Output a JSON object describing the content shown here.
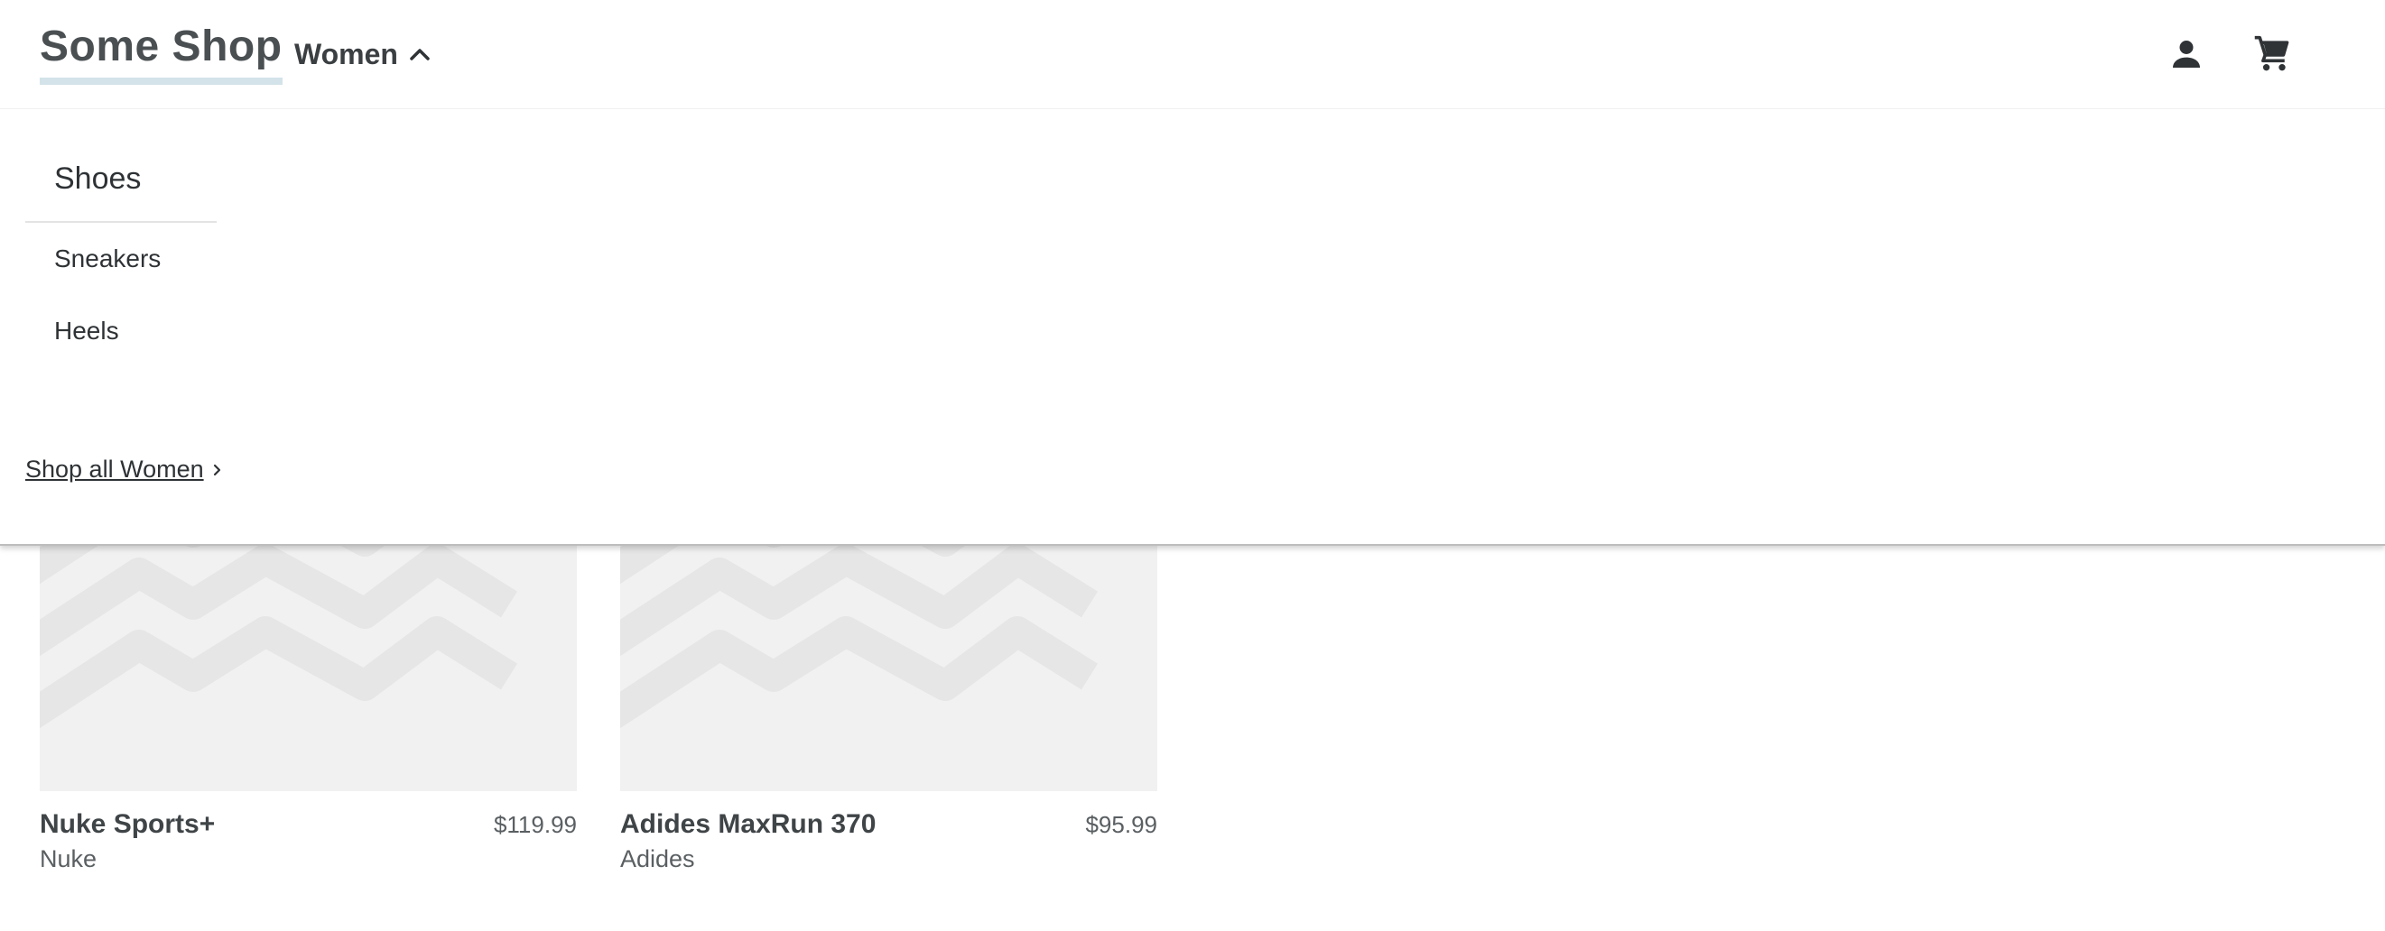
{
  "header": {
    "logo": "Some Shop",
    "nav_women": "Women",
    "account_icon": "person-icon",
    "cart_icon": "shopping-cart-icon"
  },
  "dropdown": {
    "category_heading": "Shoes",
    "links": [
      "Sneakers",
      "Heels"
    ],
    "shop_all": "Shop all Women"
  },
  "products": [
    {
      "name": "Nuke Sports+",
      "brand": "Nuke",
      "price": "$119.99"
    },
    {
      "name": "Adides MaxRun 370",
      "brand": "Adides",
      "price": "$95.99"
    }
  ],
  "colors": {
    "logo_underline": "#d3e3e9",
    "image_placeholder": "#f1f1f1",
    "placeholder_stripes": "#e6e6e6",
    "text_dark": "#3f4447"
  }
}
